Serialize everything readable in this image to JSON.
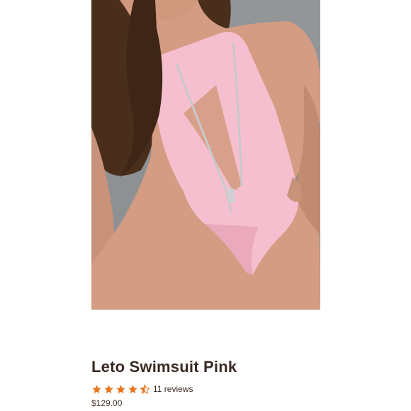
{
  "product": {
    "title": "Leto Swimsuit Pink",
    "rating": {
      "stars": 4.5,
      "max_stars": 5,
      "reviews_label": "11 reviews",
      "star_color": "#e8761e"
    },
    "price": "$129.00"
  },
  "image": {
    "subject": "model in pink zip-front one-piece swimsuit leaning on black chair",
    "swimsuit_color": "#f6bfcf",
    "background_color": "#8f9395"
  }
}
